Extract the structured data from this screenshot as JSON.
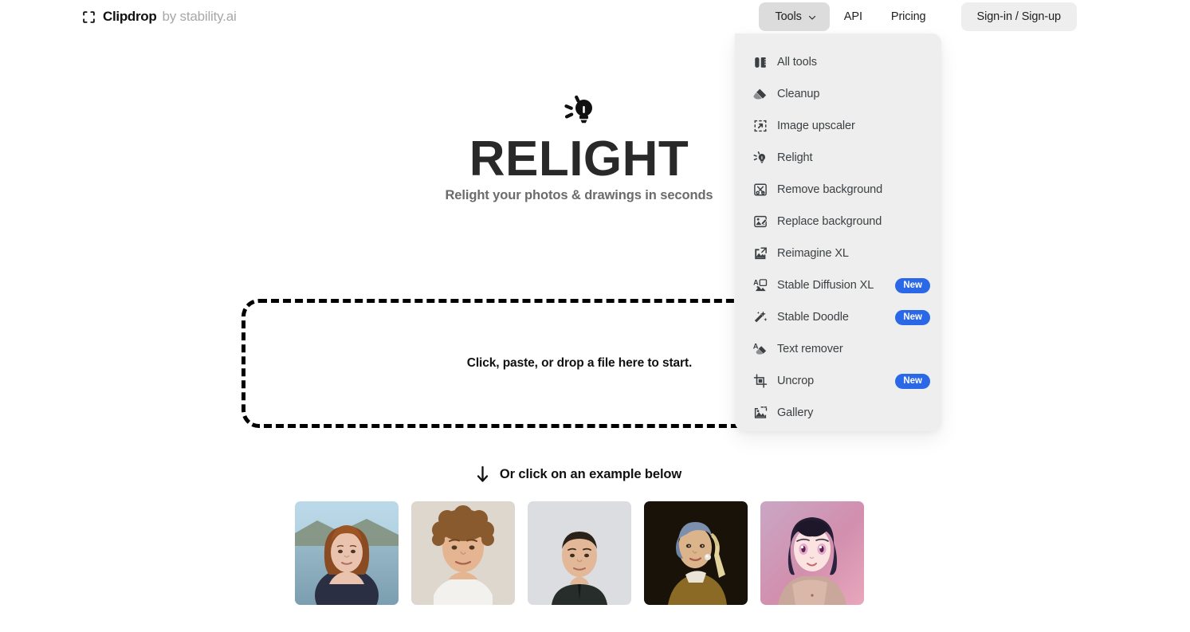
{
  "brand": {
    "icon": "clipdrop-logo-icon",
    "name": "Clipdrop",
    "by": "by stability.ai"
  },
  "nav": {
    "tools_label": "Tools",
    "tools_chevron": "chevron-down-icon",
    "api_label": "API",
    "pricing_label": "Pricing",
    "signin_label": "Sign-in / Sign-up"
  },
  "hero": {
    "icon": "lightbulb-icon",
    "title": "RELIGHT",
    "subtitle": "Relight your photos & drawings in seconds"
  },
  "dropzone": {
    "text": "Click, paste, or drop a file here to start."
  },
  "examples_section": {
    "arrow_icon": "arrow-down-icon",
    "hint": "Or click on an example below",
    "items": [
      {
        "alt": "example-portrait-redhead-woman"
      },
      {
        "alt": "example-portrait-curly-hair-man"
      },
      {
        "alt": "example-portrait-young-man-dark-shirt"
      },
      {
        "alt": "example-girl-with-pearl-earring-painting"
      },
      {
        "alt": "example-anime-girl-illustration"
      }
    ]
  },
  "dropdown": {
    "open": true,
    "badge_new_label": "New",
    "items": [
      {
        "label": "All tools",
        "icon": "all-tools-icon",
        "badge": ""
      },
      {
        "label": "Cleanup",
        "icon": "eraser-icon",
        "badge": ""
      },
      {
        "label": "Image upscaler",
        "icon": "upscale-icon",
        "badge": ""
      },
      {
        "label": "Relight",
        "icon": "lightbulb-icon",
        "badge": ""
      },
      {
        "label": "Remove background",
        "icon": "remove-background-icon",
        "badge": ""
      },
      {
        "label": "Replace background",
        "icon": "replace-background-icon",
        "badge": ""
      },
      {
        "label": "Reimagine XL",
        "icon": "reimagine-icon",
        "badge": ""
      },
      {
        "label": "Stable Diffusion XL",
        "icon": "text-to-image-icon",
        "badge": "New"
      },
      {
        "label": "Stable Doodle",
        "icon": "magic-wand-icon",
        "badge": "New"
      },
      {
        "label": "Text remover",
        "icon": "text-remover-icon",
        "badge": ""
      },
      {
        "label": "Uncrop",
        "icon": "uncrop-icon",
        "badge": ""
      },
      {
        "label": "Gallery",
        "icon": "gallery-icon",
        "badge": "New-hidden"
      }
    ]
  },
  "colors": {
    "accent_blue": "#2b68e8",
    "menu_background": "#eeeeee",
    "tools_button_background": "#dcdcdc",
    "signin_button_background": "#eeeeee",
    "page_background": "#ffffff",
    "title_color": "#292929",
    "subtitle_color": "#6b6b6b"
  }
}
